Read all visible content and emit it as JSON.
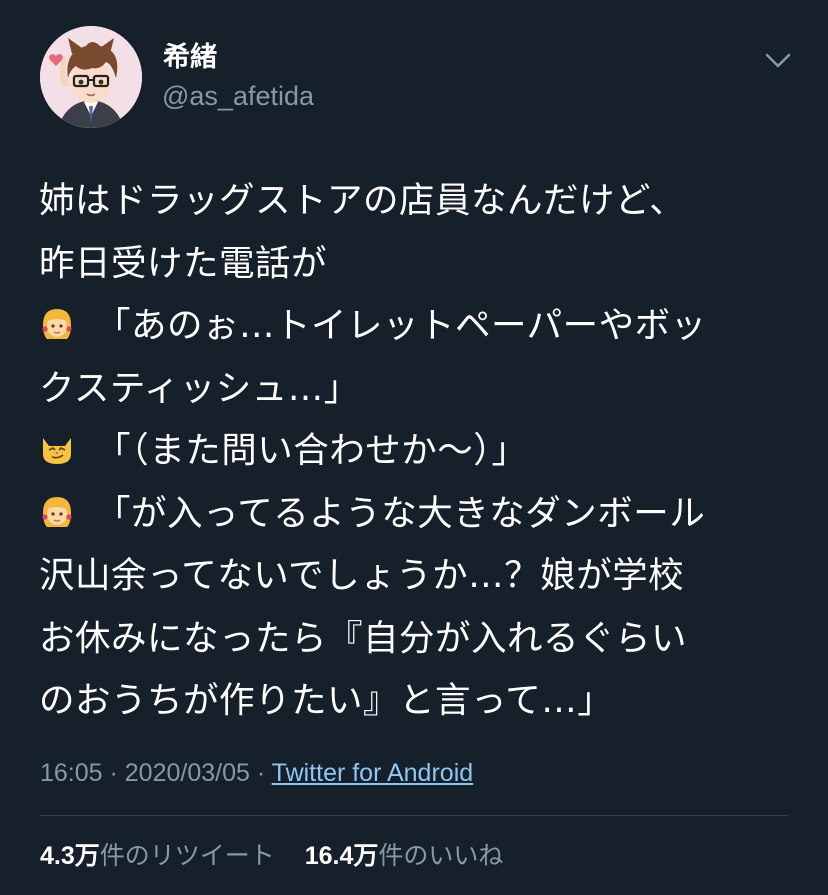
{
  "user": {
    "display_name": "希緒",
    "handle": "@as_afetida",
    "avatar_icon": "anime-avatar-glasses"
  },
  "menu_icon": "chevron-down-icon",
  "tweet": {
    "lines": [
      {
        "emoji": "",
        "text": "姉はドラッグストアの店員なんだけど、"
      },
      {
        "emoji": "",
        "text": "昨日受けた電話が"
      },
      {
        "emoji": "girl-emoji",
        "text": "「あのぉ…トイレットペーパーやボッ"
      },
      {
        "emoji": "",
        "text": "クスティッシュ…」"
      },
      {
        "emoji": "smirk-cat-emoji",
        "text": "「（また問い合わせか〜）」"
      },
      {
        "emoji": "girl-emoji",
        "text": "「が入ってるような大きなダンボール"
      },
      {
        "emoji": "",
        "text": "沢山余ってないでしょうか…？娘が学校"
      },
      {
        "emoji": "",
        "text": "お休みになったら『自分が入れるぐらい"
      },
      {
        "emoji": "",
        "text": "のおうちが作りたい』と言って…」"
      }
    ],
    "time": "16:05",
    "separator": " · ",
    "date": "2020/03/05",
    "source": "Twitter for Android"
  },
  "stats": {
    "retweets_num": "4.3万",
    "retweets_label": "件のリツイート",
    "likes_num": "16.4万",
    "likes_label": "件のいいね"
  },
  "colors": {
    "background": "#15202b",
    "secondary_text": "#8899a6",
    "link": "#8ec6f2",
    "divider": "#38444d"
  }
}
